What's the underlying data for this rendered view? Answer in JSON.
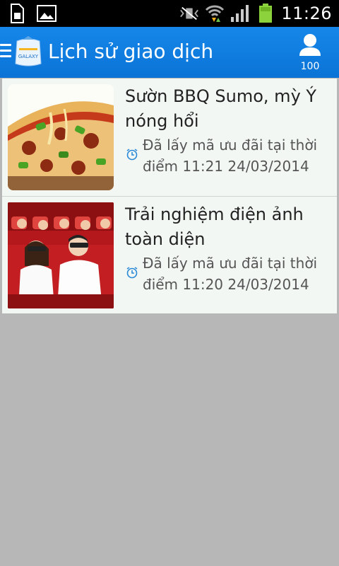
{
  "status_bar": {
    "time": "11:26",
    "icons": [
      "sim-card-icon",
      "image-icon",
      "no-vibrate-icon",
      "wifi-data-icon",
      "signal-icon",
      "battery-icon"
    ]
  },
  "app_bar": {
    "title": "Lịch sử giao dịch",
    "logo_text": "GALAXY",
    "user_count": "100",
    "accent_color": "#1687ea"
  },
  "transactions": [
    {
      "title": "Sườn BBQ Sumo, mỳ Ý nóng hổi",
      "subtitle": "Đã lấy mã ưu đãi tại thời điểm 11:21 24/03/2014",
      "image": "pizza-photo"
    },
    {
      "title": "Trải nghiệm điện ảnh toàn diện",
      "subtitle": "Đã lấy mã ưu đãi tại thời điểm 11:20 24/03/2014",
      "image": "cinema-audience-photo"
    }
  ]
}
